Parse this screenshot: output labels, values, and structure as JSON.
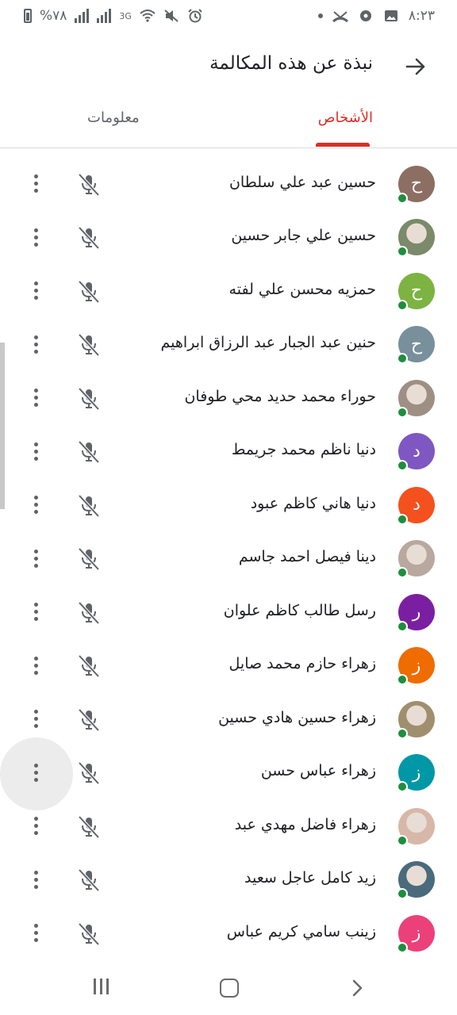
{
  "status_bar": {
    "battery": "%٧٨",
    "network": "3G",
    "time": "٨:٢٣"
  },
  "header": {
    "title": "نبذة عن هذه المكالمة"
  },
  "tabs": [
    {
      "label": "الأشخاص",
      "active": true
    },
    {
      "label": "معلومات",
      "active": false
    }
  ],
  "colors": {
    "accent": "#d93025",
    "presence": "#1e8e3e"
  },
  "participants": [
    {
      "name": "...",
      "initial": "",
      "avatar_color": "#c58af9",
      "photo": false
    },
    {
      "name": "حسين عبد علي سلطان",
      "initial": "ح",
      "avatar_color": "#8d6e63",
      "photo": false
    },
    {
      "name": "حسين علي جابر حسين",
      "initial": "",
      "avatar_color": "#7a8a6a",
      "photo": true
    },
    {
      "name": "حمزيه محسن علي لفته",
      "initial": "ح",
      "avatar_color": "#7cb342",
      "photo": false
    },
    {
      "name": "حنين عبد الجبار عبد الرزاق ابراهيم",
      "initial": "ح",
      "avatar_color": "#78909c",
      "photo": false
    },
    {
      "name": "حوراء محمد حديد محي طوفان",
      "initial": "",
      "avatar_color": "#9e8f85",
      "photo": true
    },
    {
      "name": "دنيا ناظم محمد جريمط",
      "initial": "د",
      "avatar_color": "#7e57c2",
      "photo": false
    },
    {
      "name": "دنيا هاني كاظم عبود",
      "initial": "د",
      "avatar_color": "#f4511e",
      "photo": false
    },
    {
      "name": "دينا فيصل احمد جاسم",
      "initial": "",
      "avatar_color": "#b9a8a0",
      "photo": true
    },
    {
      "name": "رسل طالب كاظم علوان",
      "initial": "ر",
      "avatar_color": "#7b1fa2",
      "photo": false
    },
    {
      "name": "زهراء حازم محمد صايل",
      "initial": "ز",
      "avatar_color": "#ef6c00",
      "photo": false
    },
    {
      "name": "زهراء حسين هادي حسين",
      "initial": "",
      "avatar_color": "#a08f6e",
      "photo": true
    },
    {
      "name": "زهراء عباس حسن",
      "initial": "ز",
      "avatar_color": "#0097a7",
      "photo": false
    },
    {
      "name": "زهراء فاضل مهدي عبد",
      "initial": "",
      "avatar_color": "#d7b7a8",
      "photo": true
    },
    {
      "name": "زيد كامل عاجل سعيد",
      "initial": "",
      "avatar_color": "#4a6b7c",
      "photo": true
    },
    {
      "name": "زينب سامي كريم عباس",
      "initial": "ز",
      "avatar_color": "#ec407a",
      "photo": false
    }
  ],
  "icons": {
    "mic": "mic-off-icon",
    "more": "more-vert-icon",
    "back": "arrow-forward-icon"
  }
}
